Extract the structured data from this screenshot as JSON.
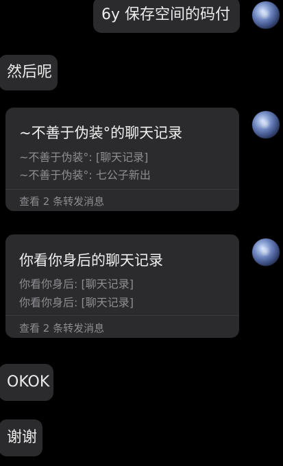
{
  "messages": {
    "m1": "6y 保存空间的码付",
    "m2": "然后呢",
    "m3": "OKOK",
    "m4": "谢谢"
  },
  "forward1": {
    "title": "~不善于伪装°的聊天记录",
    "lines": [
      "~不善于伪装°: [聊天记录]",
      "~不善于伪装°: 七公子新出"
    ],
    "footer": "查看 2 条转发消息"
  },
  "forward2": {
    "title": "你看你身后的聊天记录",
    "lines": [
      "你看你身后: [聊天记录]",
      "你看你身后: [聊天记录]"
    ],
    "footer": "查看 2 条转发消息"
  }
}
